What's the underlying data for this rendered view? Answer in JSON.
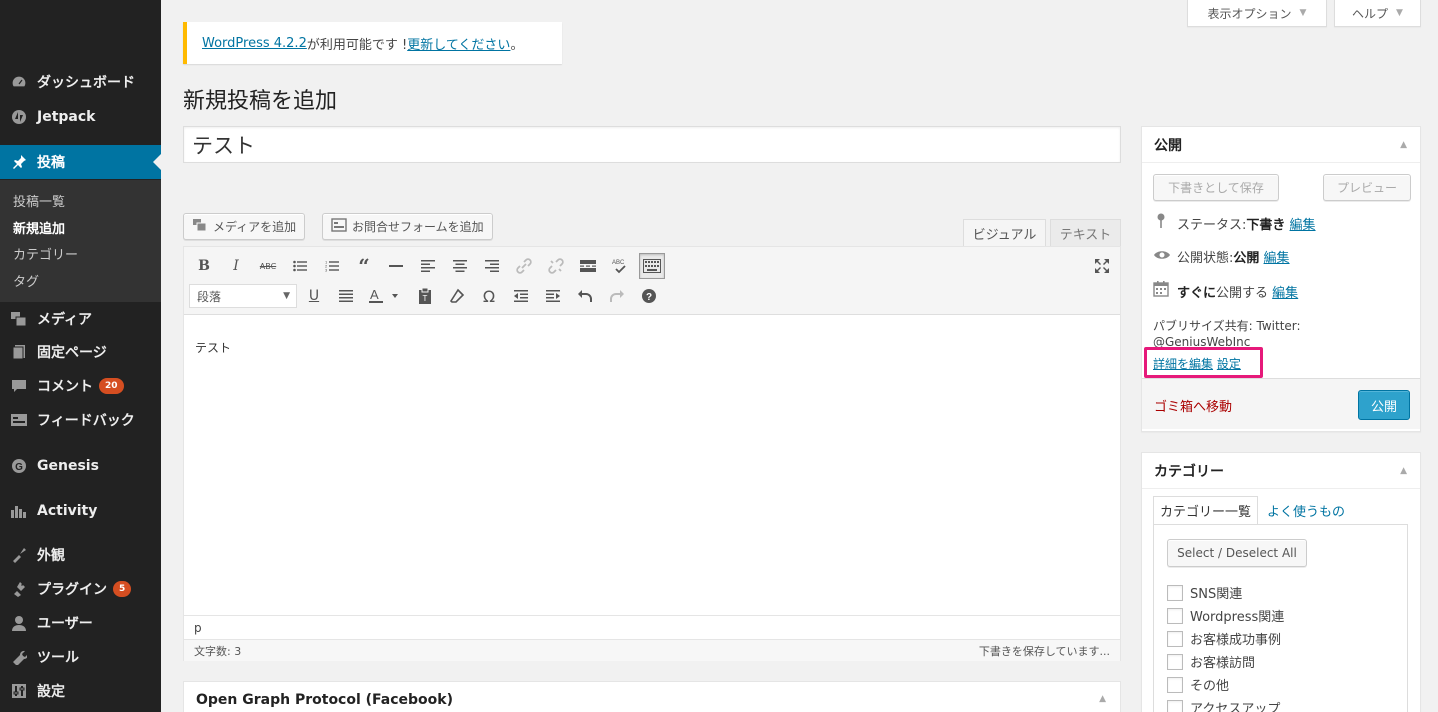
{
  "admin_menu": {
    "items": [
      {
        "label": "ダッシュボード",
        "icon": "dashboard-icon"
      },
      {
        "label": "Jetpack",
        "icon": "jetpack-icon"
      },
      {
        "label": "投稿",
        "icon": "pin-icon"
      },
      {
        "label": "メディア",
        "icon": "media-icon"
      },
      {
        "label": "固定ページ",
        "icon": "page-icon"
      },
      {
        "label": "コメント",
        "icon": "comment-icon",
        "badge": "20"
      },
      {
        "label": "フィードバック",
        "icon": "feedback-icon"
      },
      {
        "label": "Genesis",
        "icon": "genesis-icon"
      },
      {
        "label": "Activity",
        "icon": "activity-icon"
      },
      {
        "label": "外観",
        "icon": "appearance-icon"
      },
      {
        "label": "プラグイン",
        "icon": "plugin-icon",
        "badge": "5"
      },
      {
        "label": "ユーザー",
        "icon": "user-icon"
      },
      {
        "label": "ツール",
        "icon": "tools-icon"
      },
      {
        "label": "設定",
        "icon": "settings-icon"
      }
    ],
    "submenu": [
      "投稿一覧",
      "新規追加",
      "カテゴリー",
      "タグ"
    ]
  },
  "screen_meta": {
    "screen_options": "表示オプション",
    "help": "ヘルプ"
  },
  "notice": {
    "version_link": "WordPress 4.2.2",
    "middle": " が利用可能です ! ",
    "update_link": "更新してください",
    "end": "。"
  },
  "page_title": "新規投稿を追加",
  "post_title": "テスト",
  "media_buttons": {
    "add_media": "メディアを追加",
    "add_form": "お問合せフォームを追加"
  },
  "editor_tabs": {
    "visual": "ビジュアル",
    "text": "テキスト"
  },
  "toolbar": {
    "format_select": "段落"
  },
  "editor": {
    "content": "テスト",
    "path": "p",
    "word_count": "文字数: 3",
    "autosave": "下書きを保存しています..."
  },
  "og_box": {
    "title": "Open Graph Protocol (Facebook)"
  },
  "publish": {
    "title": "公開",
    "save_draft": "下書きとして保存",
    "preview": "プレビュー",
    "status_label": "ステータス: ",
    "status_value": "下書き",
    "visibility_label": "公開状態: ",
    "visibility_value": "公開",
    "schedule_bold": "すぐに",
    "schedule_rest": "公開する",
    "edit": "編集",
    "publicize_line1": "パブリサイズ共有: Twitter:",
    "publicize_line2": "@GeniusWebInc",
    "edit_details": "詳細を編集",
    "settings": "設定",
    "trash": "ゴミ箱へ移動",
    "publish_button": "公開"
  },
  "categories": {
    "title": "カテゴリー",
    "tab_all": "カテゴリー一覧",
    "tab_popular": "よく使うもの",
    "select_all": "Select / Deselect All",
    "items": [
      "SNS関連",
      "Wordpress関連",
      "お客様成功事例",
      "お客様訪問",
      "その他",
      "アクセスアップ"
    ]
  },
  "colors": {
    "menu_bg": "#222222",
    "menu_current": "#0074a2",
    "link": "#0074a2",
    "publish": "#2ea2cc",
    "highlight": "#e6197a",
    "notice": "#ffba00"
  }
}
